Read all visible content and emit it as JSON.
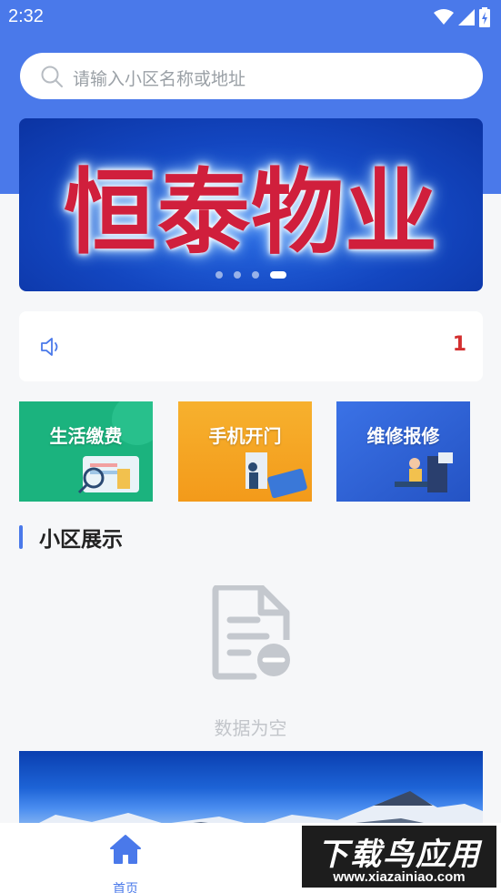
{
  "status_bar": {
    "time": "2:32"
  },
  "search": {
    "placeholder": "请输入小区名称或地址"
  },
  "banner": {
    "title": "恒泰物业",
    "dot_count": 4,
    "active_index": 3
  },
  "notice": {
    "text": "1"
  },
  "services": [
    {
      "label": "生活缴费",
      "color": "#1bb37e"
    },
    {
      "label": "手机开门",
      "color": "#f5a021"
    },
    {
      "label": "维修报修",
      "color": "#2f63d8"
    }
  ],
  "section": {
    "title": "小区展示"
  },
  "empty_state": {
    "text": "数据为空"
  },
  "tabbar": {
    "home_label": "首页"
  },
  "watermark": {
    "title": "下载鸟应用",
    "url": "www.xiazainiao.com"
  },
  "colors": {
    "primary": "#4a79ea"
  }
}
